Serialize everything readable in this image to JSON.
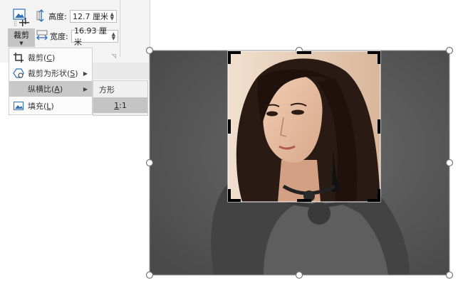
{
  "ribbon": {
    "crop_button_label": "裁剪",
    "height_label": "高度:",
    "height_value": "12.7 厘米",
    "width_label": "宽度:",
    "width_value": "16.93 厘米"
  },
  "menu": {
    "items": [
      {
        "label": "裁剪(",
        "key": "C",
        "suffix": ")",
        "icon": "crop-icon"
      },
      {
        "label": "裁剪为形状(",
        "key": "S",
        "suffix": ")",
        "icon": "shape-crop-icon"
      },
      {
        "label": "纵横比(",
        "key": "A",
        "suffix": ")",
        "icon": ""
      },
      {
        "label": "填充(",
        "key": "L",
        "suffix": ")",
        "icon": "fill-icon"
      }
    ],
    "active_index": 2
  },
  "submenu": {
    "header": "方形",
    "option_key": "1",
    "option_rest": ":1"
  },
  "colors": {
    "ribbon_bg": "#f3f3f3",
    "menu_active": "#c8c8c8",
    "dimmed_image": "#595959"
  }
}
